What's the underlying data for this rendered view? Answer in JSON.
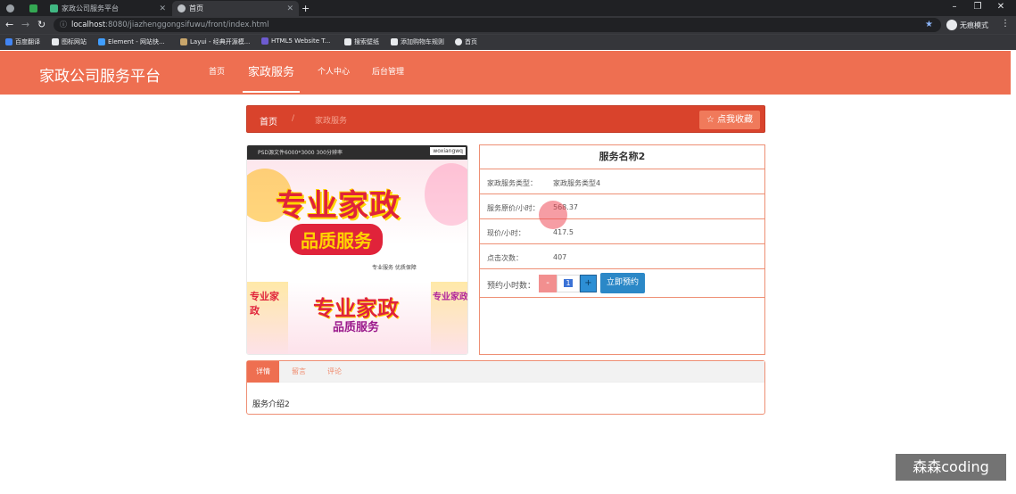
{
  "browser": {
    "tabs": [
      {
        "label": "家政公司服务平台"
      },
      {
        "label": "首页"
      }
    ],
    "new_tab": "+",
    "window_controls": [
      "–",
      "❐",
      "✕"
    ],
    "url_host": "localhost",
    "url_rest": ":8080/jiazhenggongsifuwu/front/index.html",
    "profile_label": "无痕模式",
    "bookmarks": [
      "百度翻译",
      "图标网站",
      "Element - 网站快...",
      "Layui - 经典开源模...",
      "HTML5 Website T...",
      "搜索壁纸",
      "添加购物车规则",
      "首页"
    ]
  },
  "header": {
    "brand": "家政公司服务平台",
    "menu": [
      {
        "label": "首页"
      },
      {
        "label": "家政服务"
      },
      {
        "label": "个人中心"
      },
      {
        "label": "后台管理"
      }
    ]
  },
  "breadcrumb": {
    "home": "首页",
    "separator": "/",
    "current": "家政服务",
    "favorite_label": "☆ 点我收藏"
  },
  "gallery": {
    "top_caption": "PSD源文件6000*3000 300分辨率",
    "top_tag": "woxiangwq",
    "title_line1": "专业家政",
    "title_line2": "品质服务",
    "footer_text": "专业服务  优质保障"
  },
  "info": {
    "title": "服务名称2",
    "rows": [
      {
        "label": "家政服务类型：",
        "value": "家政服务类型4"
      },
      {
        "label": "服务原价/小时：",
        "value": "568.37"
      },
      {
        "label": "现价/小时：",
        "value": "417.5"
      },
      {
        "label": "点击次数：",
        "value": "407"
      }
    ],
    "qty_label": "预约小时数：",
    "qty_minus": "-",
    "qty_value": "1",
    "qty_plus": "+",
    "book_button": "立即预约"
  },
  "detail_tabs": {
    "tabs": [
      {
        "label": "详情"
      },
      {
        "label": "留言"
      },
      {
        "label": "评论"
      }
    ],
    "content": "服务介绍2"
  },
  "watermark": "森森coding",
  "colors": {
    "primary": "#ee6f51",
    "breadcrumb": "#d9432c",
    "button": "#2b88c7"
  }
}
